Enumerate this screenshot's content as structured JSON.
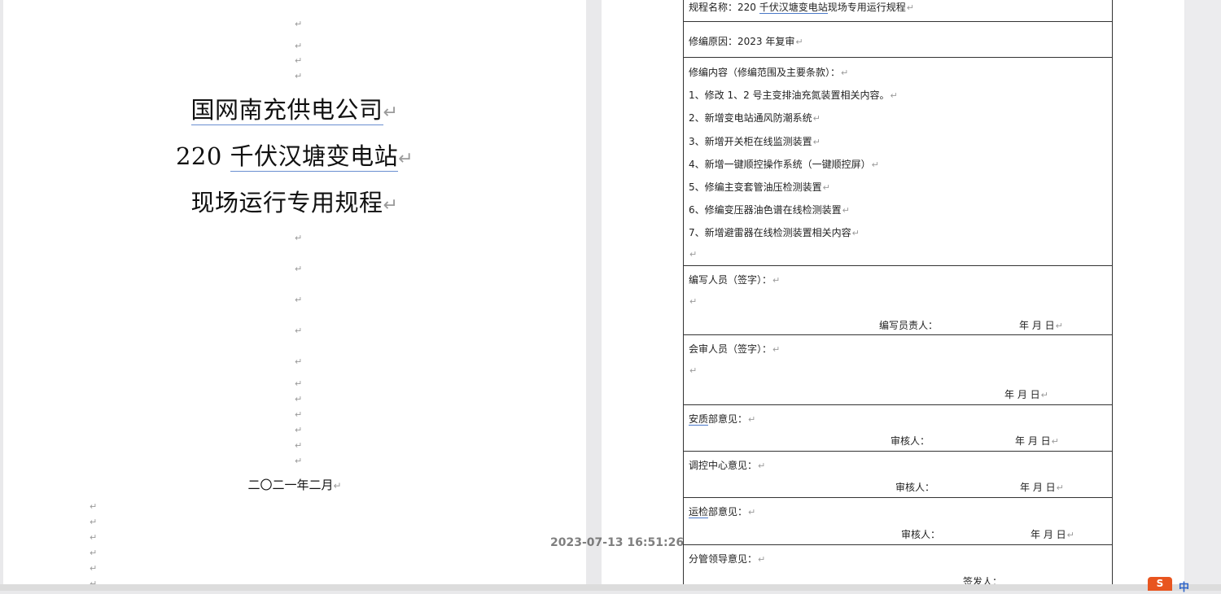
{
  "left_page": {
    "title_lines": [
      "国网南充供电公司",
      "220千伏汉塘变电站",
      "现场运行专用规程"
    ],
    "title_line2_prefix": "220 ",
    "title_line2_rest": "千伏汉塘变电站",
    "date": "二〇二一年二月",
    "return_mark": "↵"
  },
  "right_page": {
    "reg_name_label": "规程名称：220 ",
    "reg_name_underlined": "千伏汉塘变电站",
    "reg_name_rest": "现场专用运行规程",
    "revision_reason": "修编原因：2023 年复审",
    "content_heading": "修编内容（修编范围及主要条款）：",
    "content_items": [
      "1、修改 1、2 号主变排油充氮装置相关内容。",
      "2、新增变电站通风防潮系统",
      "3、新增开关柜在线监测装置",
      "4、新增一键顺控操作系统（一键顺控屏）",
      "5、修编主变套管油压检测装置",
      "6、修编变压器油色谱在线检测装置",
      "7、新增避雷器在线检测装置相关内容"
    ],
    "writer_label": "编写人员（签字）：",
    "writer_lead_label": "编写员责人：",
    "date_ymd": "年    月    日",
    "reviewer_label": "会审人员（签字）：",
    "safety_prefix": "安质",
    "safety_rest": "部意见：",
    "checker_label": "审核人：",
    "dispatch_label": "调控中心意见：",
    "ops_prefix": "运检",
    "ops_rest": "部意见：",
    "leader_label": "分管领导意见：",
    "issuer_label": "签发人："
  },
  "overlay": {
    "timestamp": "2023-07-13 16:51:26",
    "ime_badge": "S",
    "ime_text": "中"
  },
  "colors": {
    "underline": "#6a8fd0",
    "wavy_underline": "#4a78c8",
    "ime_orange": "#e8551f",
    "ime_blue": "#2d64c8"
  }
}
